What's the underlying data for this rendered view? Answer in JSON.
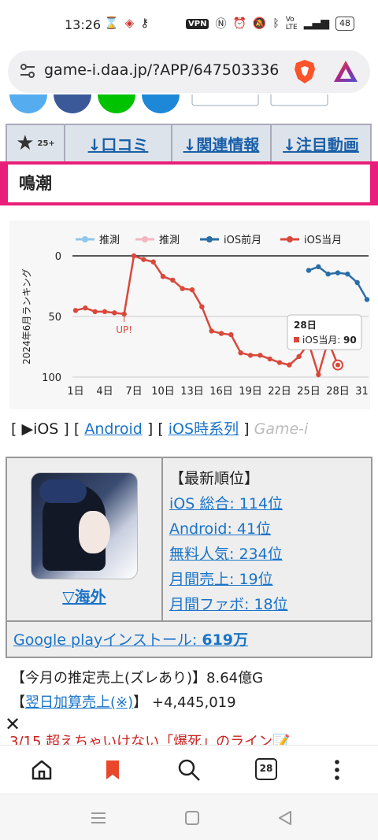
{
  "status": {
    "time": "13:26",
    "vpn": "VPN",
    "battery": "48"
  },
  "browser": {
    "url": "game-i.daa.jp/?APP/647503336",
    "tab_count": "28"
  },
  "tabs": {
    "star_count": "25+",
    "reviews": "↓口コミ",
    "related": "↓関連情報",
    "videos": "↓注目動画"
  },
  "game_title": "鳴潮",
  "chart_data": {
    "type": "line",
    "ylabel": "2024年6月ランキング",
    "ylim": [
      0,
      100
    ],
    "y_ticks": [
      "0",
      "50",
      "100"
    ],
    "x_ticks": [
      "1日",
      "4日",
      "7日",
      "10日",
      "13日",
      "16日",
      "19日",
      "22日",
      "25日",
      "28日",
      "31日"
    ],
    "legend": [
      "推測",
      "推測",
      "iOS前月",
      "iOS当月"
    ],
    "series": [
      {
        "name": "iOS当月",
        "color": "#d9483b",
        "x": [
          1,
          2,
          3,
          4,
          5,
          6,
          7,
          8,
          9,
          10,
          11,
          12,
          13,
          14,
          15,
          16,
          17,
          18,
          19,
          20,
          21,
          22,
          23,
          24,
          25,
          26,
          27,
          28
        ],
        "values": [
          45,
          43,
          46,
          46,
          47,
          48,
          0,
          3,
          5,
          17,
          20,
          27,
          28,
          42,
          62,
          64,
          65,
          80,
          82,
          82,
          85,
          88,
          90,
          83,
          72,
          98,
          70,
          90
        ]
      },
      {
        "name": "iOS前月",
        "color": "#2a6ea6",
        "x": [
          25,
          26,
          27,
          28,
          29,
          30,
          31
        ],
        "values": [
          12,
          9,
          15,
          14,
          15,
          22,
          36
        ]
      }
    ],
    "annotation": "UP!",
    "tooltip": {
      "title": "28日",
      "label": "iOS当月:",
      "value": "90"
    }
  },
  "platform_links": {
    "ios": "[ ▶iOS ]",
    "lb1": "[",
    "android": "Android",
    "rb1": "]",
    "lb2": "[",
    "timeline": "iOS時系列",
    "rb2": "]",
    "brand": "Game-i"
  },
  "info": {
    "region": "▽海外",
    "latest_header": "【最新順位】",
    "ios_total": "iOS 総合: 114位",
    "android": "Android: 41位",
    "free": "無料人気: 234位",
    "monthly_sales": "月間売上: 19位",
    "monthly_fav": "月間ファボ: 18位",
    "gp_label": "Google playインストール: ",
    "gp_value": "619万"
  },
  "sales": {
    "estimate_label": "【今月の推定売上(ズレあり)】",
    "estimate_value": "8.64億G",
    "next_day_open": "【",
    "next_day_link": "翌日加算売上(※)",
    "next_day_close": "】",
    "next_day_value": "+4,445,019"
  },
  "news": {
    "text": "3/15 超えちゃいけない「爆死」のライン📝"
  }
}
